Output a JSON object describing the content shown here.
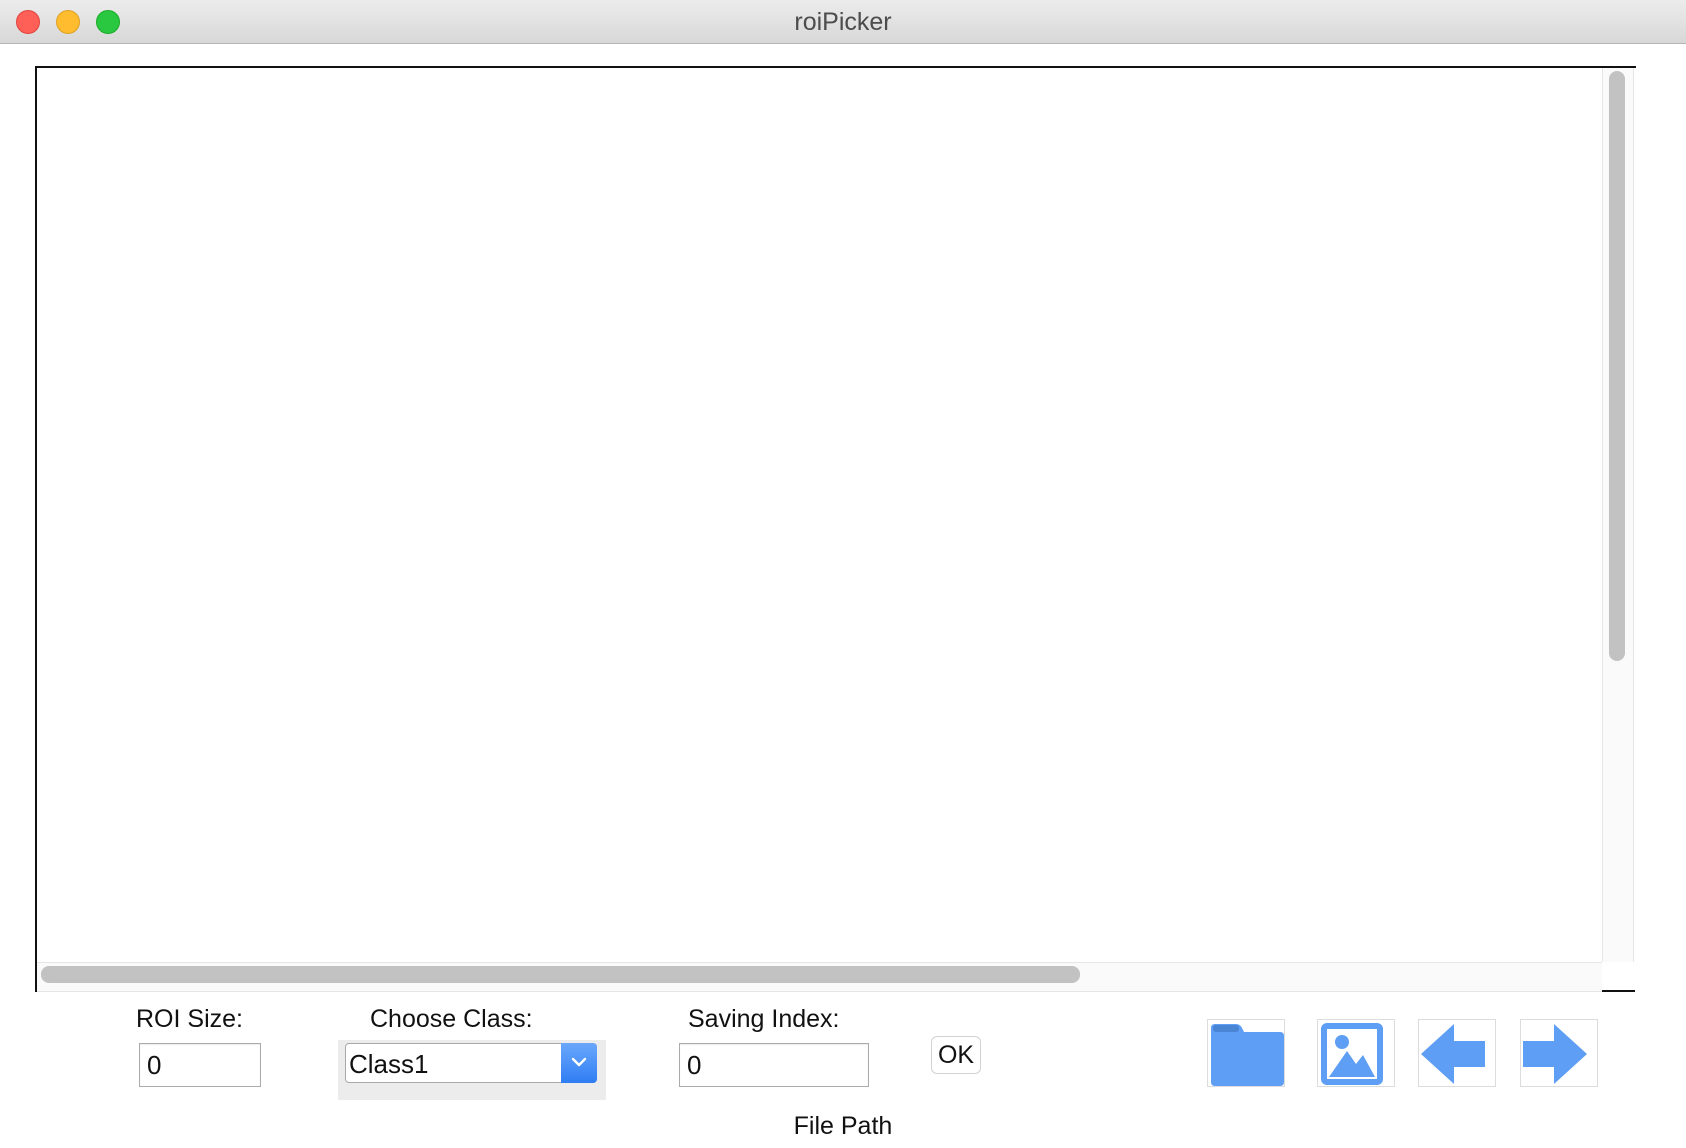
{
  "window": {
    "title": "roiPicker"
  },
  "controls": {
    "roi_size": {
      "label": "ROI Size:",
      "value": "0"
    },
    "choose_class": {
      "label": "Choose Class:",
      "selected": "Class1"
    },
    "saving_index": {
      "label": "Saving Index:",
      "value": "0"
    },
    "ok_label": "OK"
  },
  "toolbar": {
    "icons": [
      "folder-icon",
      "image-icon",
      "arrow-left-icon",
      "arrow-right-icon"
    ]
  },
  "status": {
    "file_path": "File Path"
  },
  "colors": {
    "accent": "#5e9ef4",
    "close": "#fe5f57",
    "minimize": "#febc2e",
    "maximize": "#29c840"
  }
}
